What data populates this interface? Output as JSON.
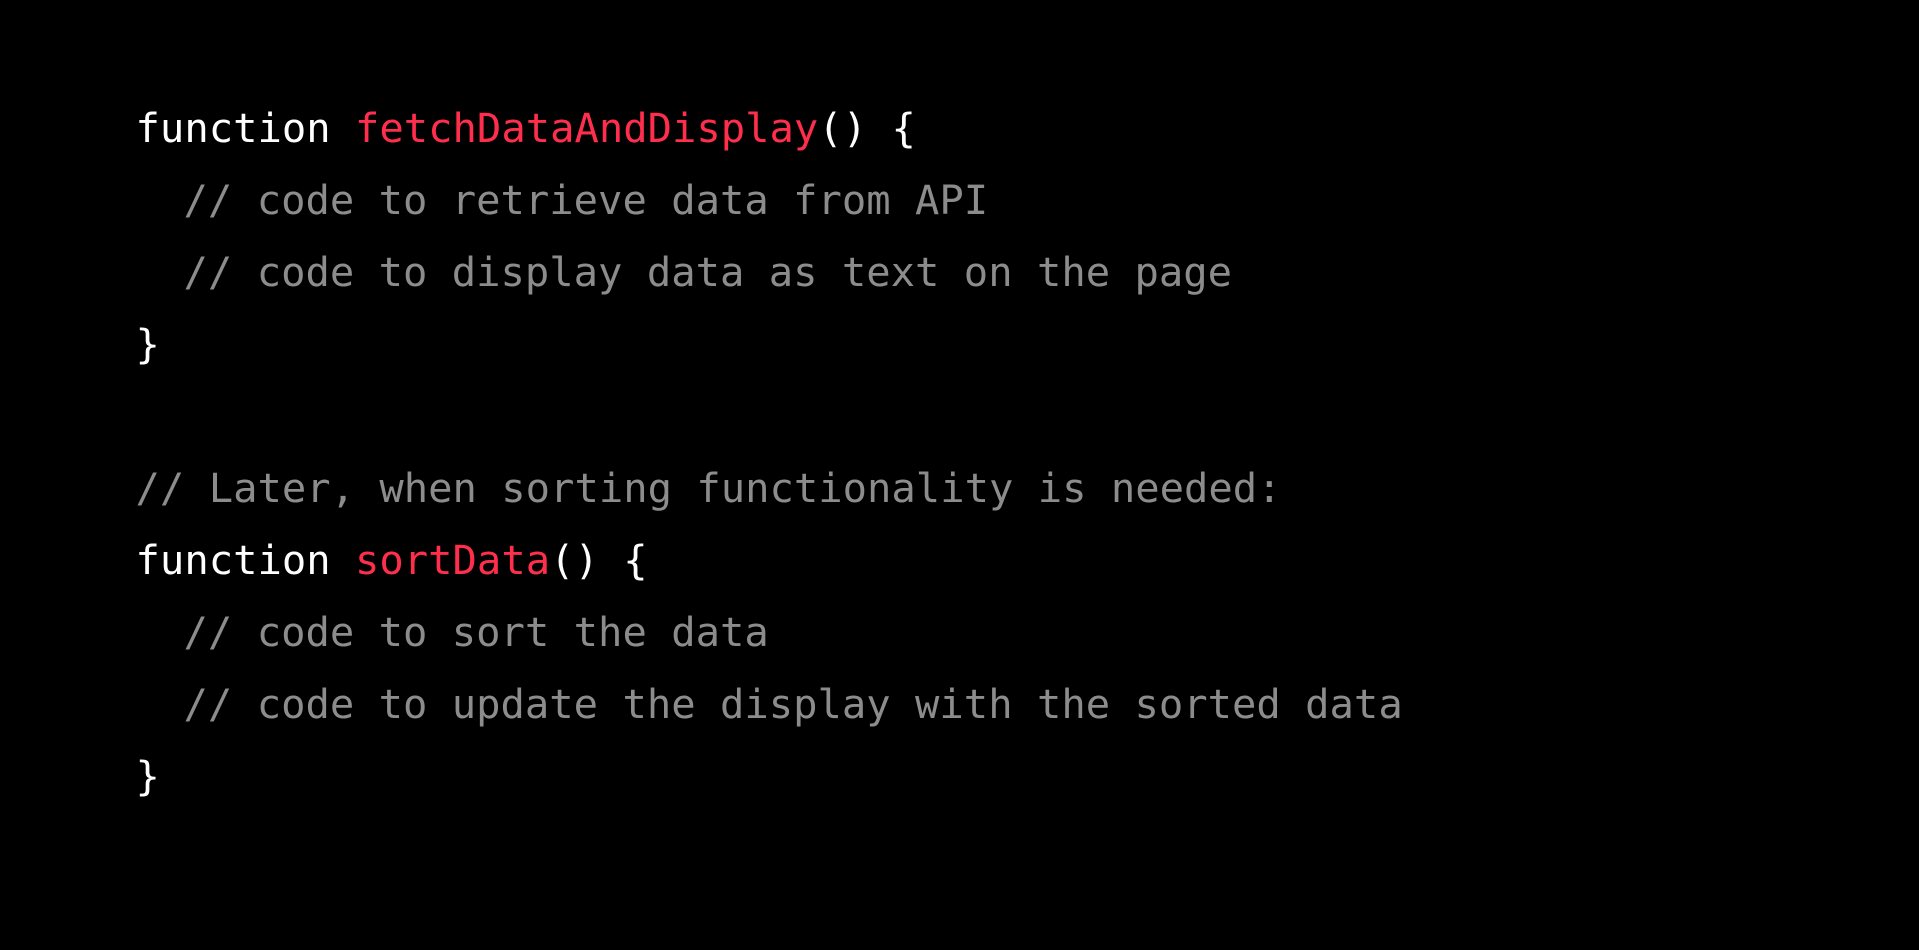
{
  "code": {
    "line1": {
      "keyword": "function",
      "name": "fetchDataAndDisplay",
      "rest": "() {"
    },
    "line2": "// code to retrieve data from API",
    "line3": "// code to display data as text on the page",
    "line4": "}",
    "line6": "// Later, when sorting functionality is needed:",
    "line7": {
      "keyword": "function",
      "name": "sortData",
      "rest": "() {"
    },
    "line8": "// code to sort the data",
    "line9": "// code to update the display with the sorted data",
    "line10": "}"
  },
  "colors": {
    "background": "#000000",
    "keyword": "#ffffff",
    "function_name": "#ff2e4c",
    "comment": "#8c8c8c"
  }
}
